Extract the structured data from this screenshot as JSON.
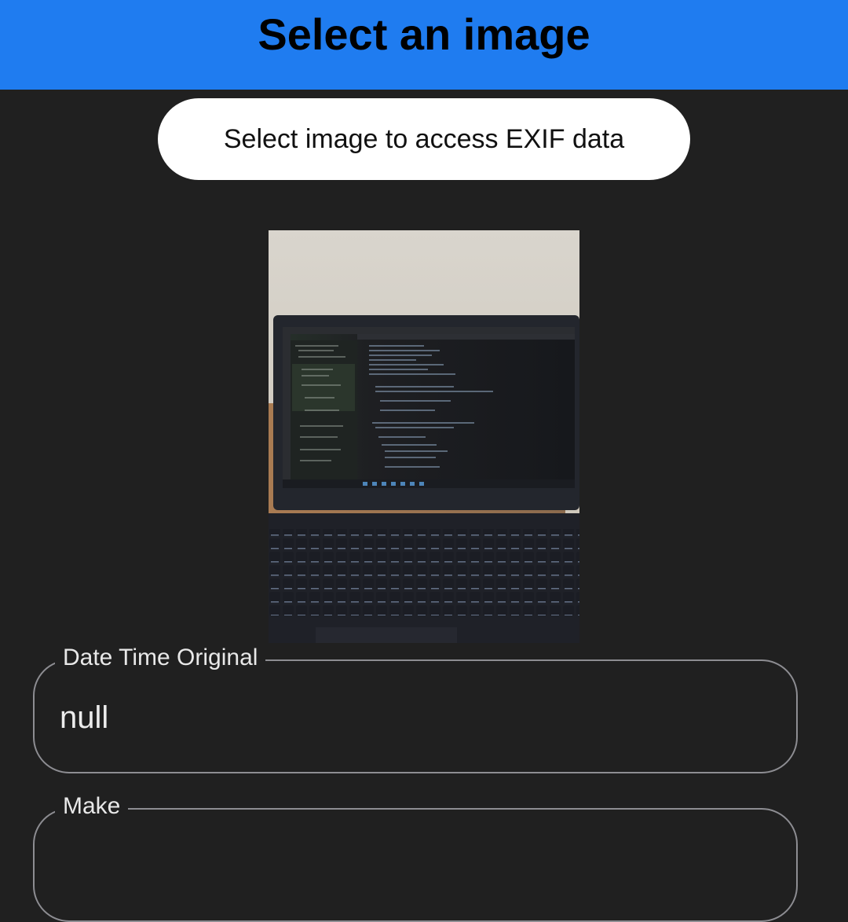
{
  "app_bar": {
    "title": "Select an image"
  },
  "select_button": {
    "label": "Select image to access EXIF data"
  },
  "image_preview": {
    "alt": "Selected image"
  },
  "fields": [
    {
      "label": "Date Time Original",
      "value": "null"
    },
    {
      "label": "Make",
      "value": ""
    }
  ],
  "colors": {
    "app_bar": "#1f7cf0",
    "background": "#202020",
    "button": "#ffffff",
    "field_border": "#8d8d92"
  }
}
